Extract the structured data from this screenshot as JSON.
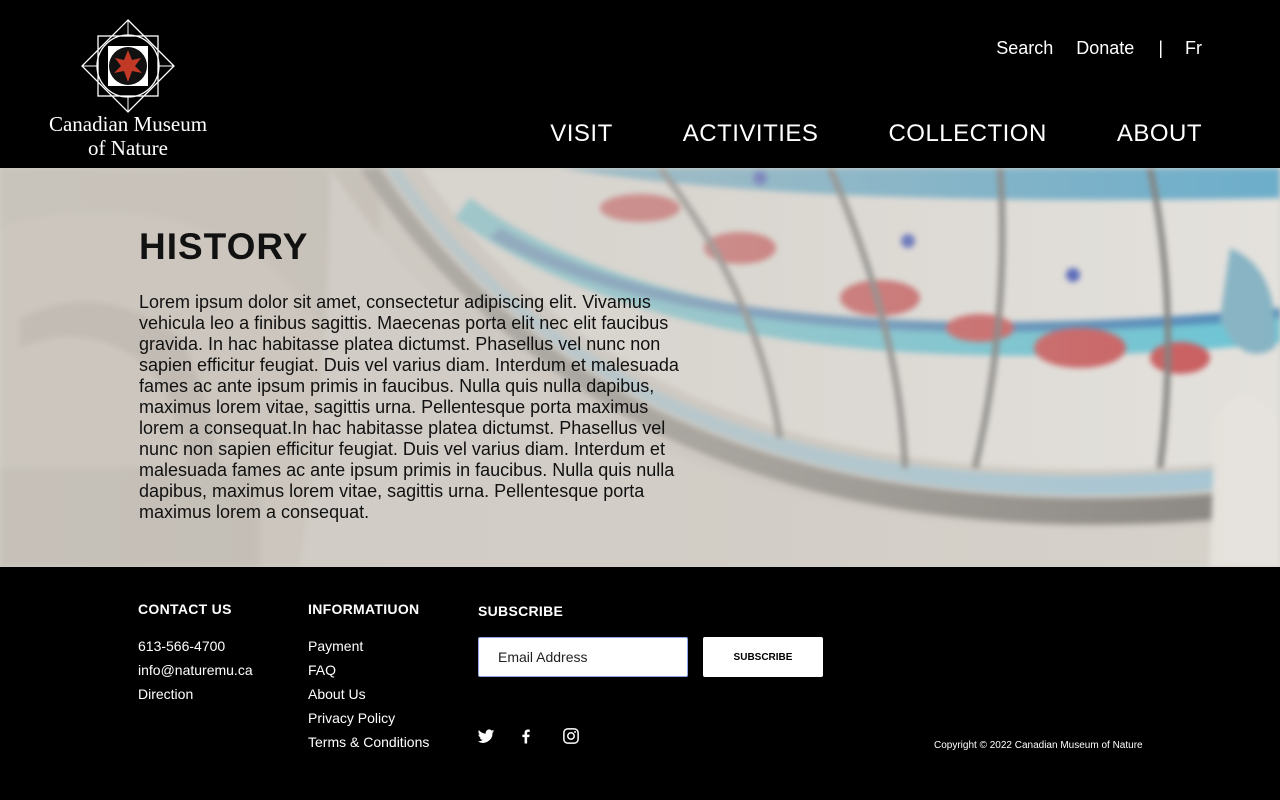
{
  "logo": {
    "line1": "Canadian Museum",
    "line2": "of Nature"
  },
  "utility": {
    "search": "Search",
    "donate": "Donate",
    "separator": "|",
    "language": "Fr"
  },
  "nav": {
    "visit": "VISIT",
    "activities": "ACTIVITIES",
    "collection": "COLLECTION",
    "about": "ABOUT"
  },
  "hero": {
    "title": "HISTORY",
    "body": "Lorem ipsum dolor sit amet, consectetur adipiscing elit. Vivamus vehicula leo a finibus sagittis. Maecenas porta elit nec elit faucibus gravida. In hac habitasse platea dictumst. Phasellus vel nunc non sapien efficitur feugiat. Duis vel varius diam. Interdum et malesuada fames ac ante ipsum primis in faucibus. Nulla quis nulla dapibus, maximus lorem vitae, sagittis urna. Pellentesque porta maximus lorem a consequat.In hac habitasse platea dictumst. Phasellus vel nunc non sapien efficitur feugiat. Duis vel varius diam. Interdum et malesuada fames ac ante ipsum primis in faucibus. Nulla quis nulla dapibus, maximus lorem vitae, sagittis urna. Pellentesque porta maximus lorem a consequat."
  },
  "footer": {
    "contact": {
      "heading": "CONTACT US",
      "phone": "613-566-4700",
      "email": "info@naturemu.ca",
      "direction": "Direction"
    },
    "info": {
      "heading": "INFORMATIUON",
      "items": [
        "Payment",
        "FAQ",
        "About Us",
        "Privacy Policy",
        "Terms & Conditions"
      ]
    },
    "subscribe": {
      "heading": "SUBSCRIBE",
      "placeholder": "Email Address",
      "button": "SUBSCRIBE"
    },
    "social": [
      "twitter-icon",
      "facebook-icon",
      "instagram-icon"
    ],
    "copyright": "Copyright © 2022 Canadian Museum of Nature"
  },
  "colors": {
    "background": "#000000",
    "text": "#ffffff",
    "input_border": "#8fa6e6"
  }
}
